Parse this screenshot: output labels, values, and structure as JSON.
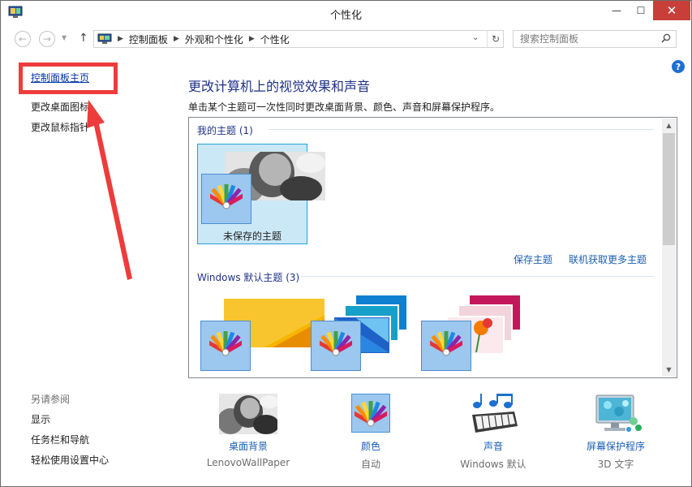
{
  "window": {
    "title": "个性化",
    "close_glyph": "✕",
    "min_glyph": "—",
    "max_glyph": "☐"
  },
  "address": {
    "crumbs": [
      "控制面板",
      "外观和个性化",
      "个性化"
    ],
    "search_placeholder": "搜索控制面板"
  },
  "left_pane": {
    "home_link": "控制面板主页",
    "links": [
      "更改桌面图标",
      "更改鼠标指针"
    ],
    "see_also_label": "另请参阅",
    "see_also_links": [
      "显示",
      "任务栏和导航",
      "轻松使用设置中心"
    ]
  },
  "main": {
    "title": "更改计算机上的视觉效果和声音",
    "description": "单击某个主题可一次性同时更改桌面背景、颜色、声音和屏幕保护程序。",
    "my_themes_header": "我的主题 (1)",
    "unsaved_theme": "未保存的主题",
    "save_theme": "保存主题",
    "get_more_themes": "联机获取更多主题",
    "default_themes_header": "Windows 默认主题 (3)"
  },
  "bottom": [
    {
      "label": "桌面背景",
      "sub": "LenovoWallPaper",
      "icon": "wallpaper-icon"
    },
    {
      "label": "颜色",
      "sub": "自动",
      "icon": "color-icon"
    },
    {
      "label": "声音",
      "sub": "Windows 默认",
      "icon": "sound-icon"
    },
    {
      "label": "屏幕保护程序",
      "sub": "3D 文字",
      "icon": "screensaver-icon"
    }
  ],
  "colors": {
    "accent_red": "#ee3b3b",
    "link_blue": "#1a5fb4",
    "header_blue": "#1e3287",
    "selected_bg": "#cbe8f6"
  }
}
